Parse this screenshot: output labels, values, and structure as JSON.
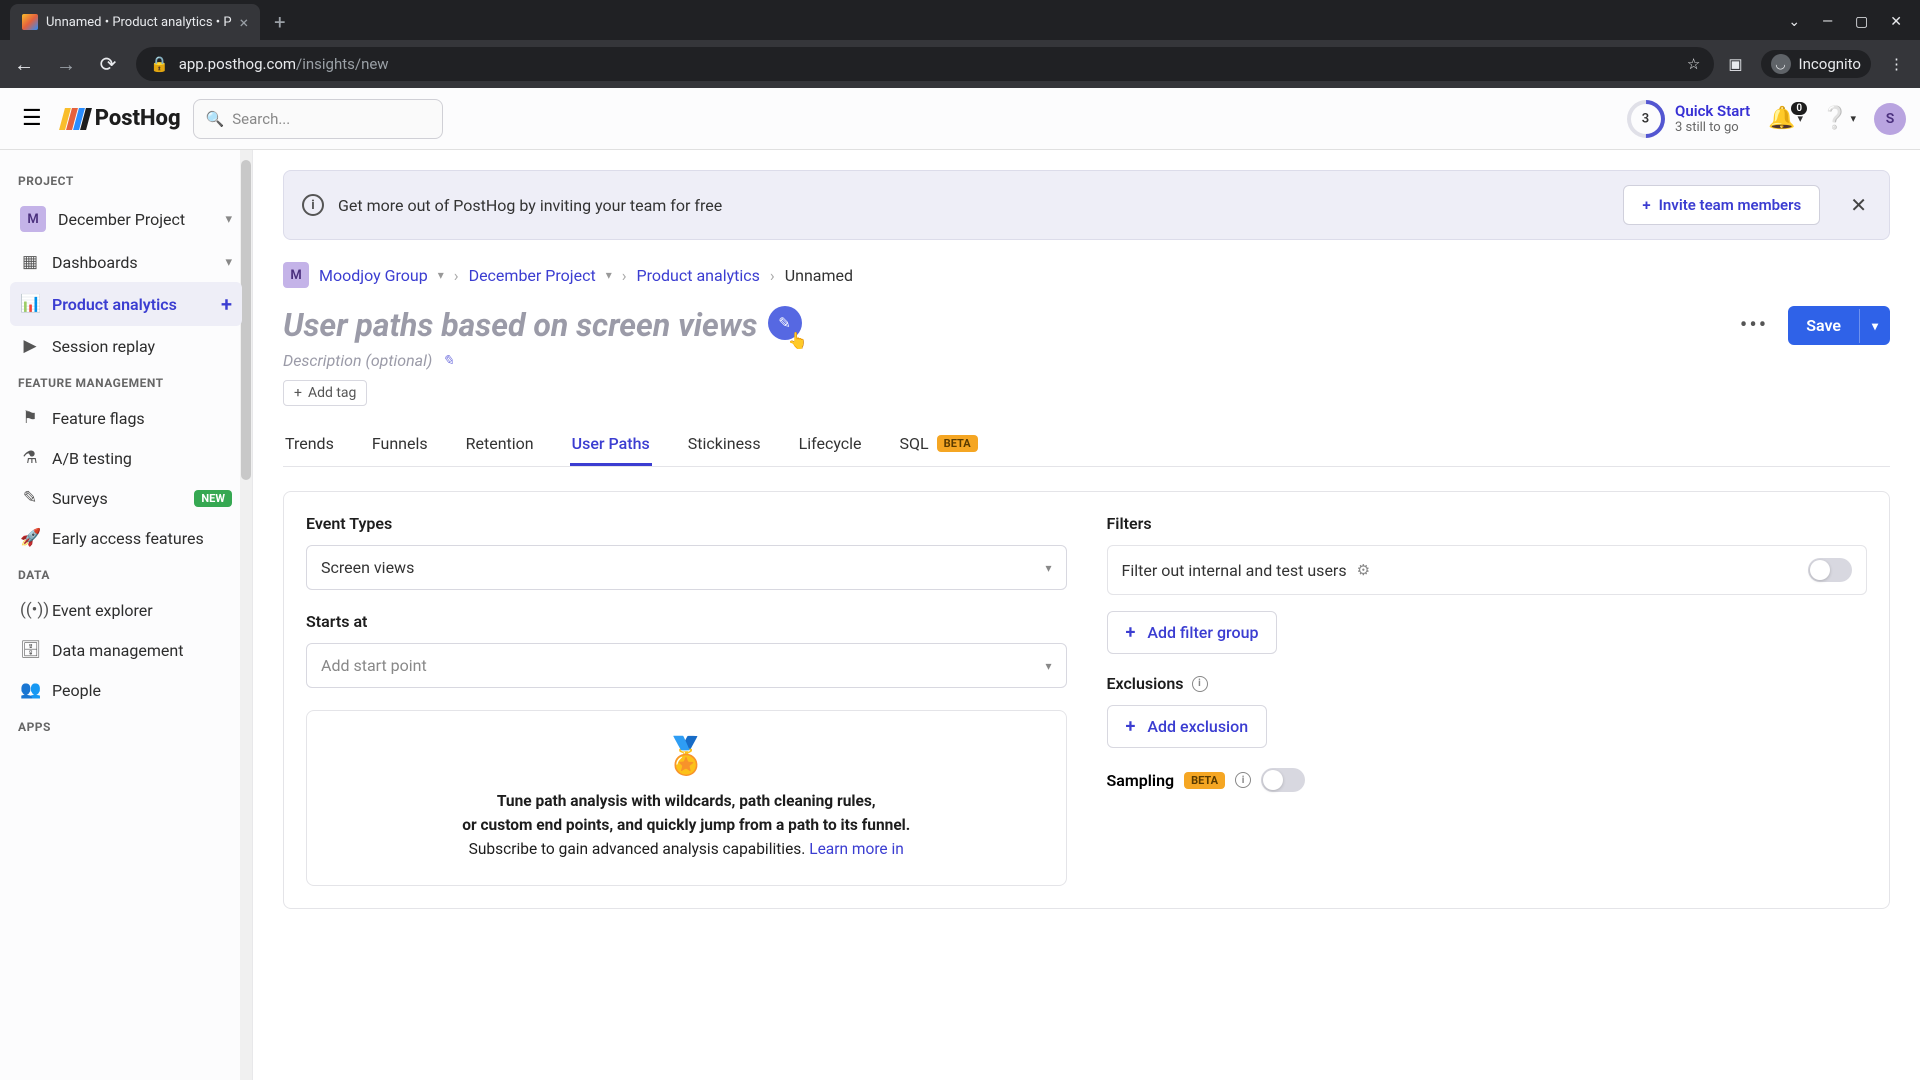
{
  "browser": {
    "tab_title": "Unnamed • Product analytics • P",
    "url_host": "app.posthog.com",
    "url_path": "/insights/new",
    "incognito_label": "Incognito"
  },
  "header": {
    "logo_text": "PostHog",
    "search_placeholder": "Search...",
    "quick_start_title": "Quick Start",
    "quick_start_sub": "3 still to go",
    "quick_start_count": "3",
    "notif_badge": "0",
    "avatar_letter": "S"
  },
  "sidebar": {
    "sections": {
      "project": "PROJECT",
      "feature": "FEATURE MANAGEMENT",
      "data": "DATA",
      "apps": "APPS"
    },
    "project_name": "December Project",
    "project_avatar": "M",
    "items": {
      "dashboards": "Dashboards",
      "analytics": "Product analytics",
      "session": "Session replay",
      "flags": "Feature flags",
      "ab": "A/B testing",
      "surveys": "Surveys",
      "early": "Early access features",
      "explorer": "Event explorer",
      "dataman": "Data management",
      "people": "People"
    },
    "new_label": "NEW"
  },
  "banner": {
    "text": "Get more out of PostHog by inviting your team for free",
    "button": "Invite team members"
  },
  "breadcrumb": {
    "org_avatar": "M",
    "org": "Moodjoy Group",
    "project": "December Project",
    "section": "Product analytics",
    "current": "Unnamed"
  },
  "insight": {
    "title": "User paths based on screen views",
    "description_placeholder": "Description (optional)",
    "add_tag": "Add tag",
    "save": "Save"
  },
  "tabs": [
    "Trends",
    "Funnels",
    "Retention",
    "User Paths",
    "Stickiness",
    "Lifecycle",
    "SQL"
  ],
  "beta_label": "BETA",
  "config": {
    "event_types_label": "Event Types",
    "event_types_value": "Screen views",
    "starts_at_label": "Starts at",
    "starts_at_placeholder": "Add start point",
    "filters_label": "Filters",
    "filter_internal": "Filter out internal and test users",
    "add_filter_group": "Add filter group",
    "exclusions_label": "Exclusions",
    "add_exclusion": "Add exclusion",
    "sampling_label": "Sampling",
    "promo_line1": "Tune path analysis with wildcards, path cleaning rules,",
    "promo_line2": "or custom end points, and quickly jump from a path to its funnel.",
    "promo_line3": "Subscribe to gain advanced analysis capabilities.",
    "promo_link": "Learn more in"
  }
}
